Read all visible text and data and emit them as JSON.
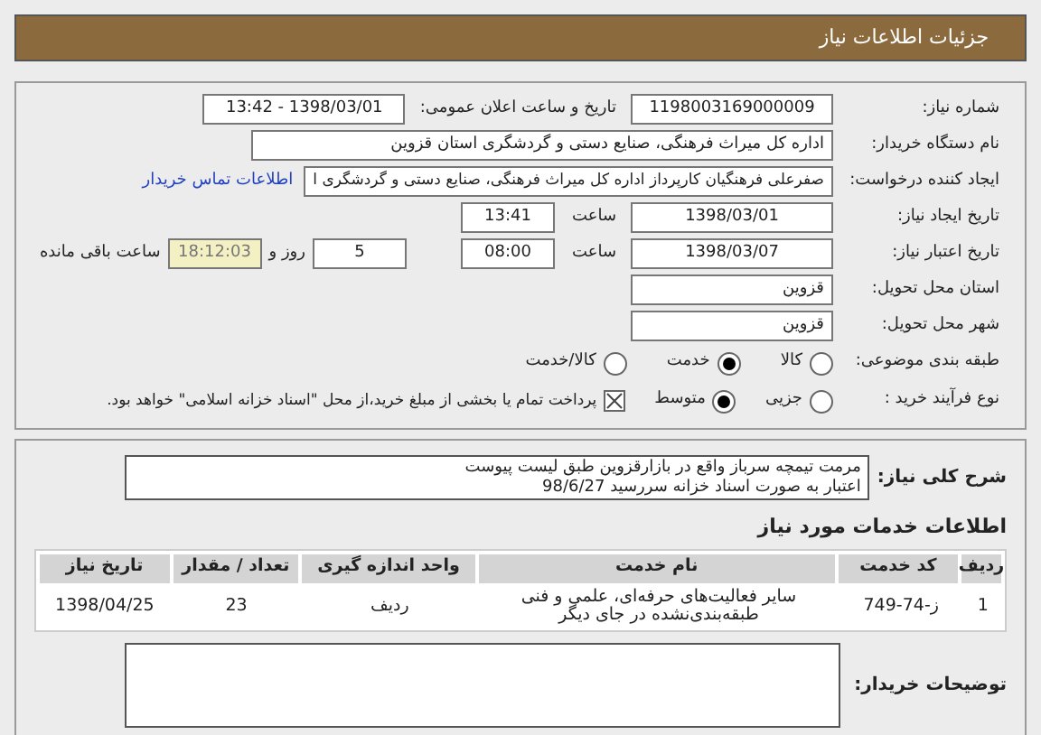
{
  "header": {
    "title": "جزئیات اطلاعات نیاز"
  },
  "fields": {
    "need_number": {
      "label": "شماره نیاز:",
      "value": "1198003169000009"
    },
    "announce": {
      "label": "تاریخ و ساعت اعلان عمومی:",
      "value": "1398/03/01 - 13:42"
    },
    "buyer": {
      "label": "نام دستگاه خریدار:",
      "value": "اداره کل میراث فرهنگی، صنایع دستی و گردشگری استان قزوین"
    },
    "creator": {
      "label": "ایجاد کننده درخواست:",
      "value": "صفرعلی فرهنگیان کارپرداز اداره کل میراث فرهنگی، صنایع دستی و گردشگری ا",
      "link": "اطلاعات تماس خریدار"
    },
    "created": {
      "label": "تاریخ ایجاد نیاز:",
      "date": "1398/03/01",
      "time_label": "ساعت",
      "time": "13:41"
    },
    "validity": {
      "label": "تاریخ اعتبار نیاز:",
      "date": "1398/03/07",
      "time_label": "ساعت",
      "time": "08:00",
      "days": "5",
      "days_label": "روز و",
      "remaining": "18:12:03",
      "remaining_label": "ساعت باقی مانده"
    },
    "province": {
      "label": "استان محل تحویل:",
      "value": "قزوین"
    },
    "city": {
      "label": "شهر محل تحویل:",
      "value": "قزوین"
    }
  },
  "category": {
    "label": "طبقه بندی موضوعی:",
    "options": [
      {
        "label": "کالا",
        "selected": false
      },
      {
        "label": "خدمت",
        "selected": true
      },
      {
        "label": "کالا/خدمت",
        "selected": false
      }
    ]
  },
  "process": {
    "label": "نوع فرآیند خرید :",
    "options": [
      {
        "label": "جزیی",
        "selected": false
      },
      {
        "label": "متوسط",
        "selected": true
      }
    ],
    "treasury": {
      "checked": true,
      "text": "پرداخت تمام یا بخشی از مبلغ خرید،از محل \"اسناد خزانه اسلامی\" خواهد بود."
    }
  },
  "description": {
    "label": "شرح کلی نیاز:",
    "lines": [
      "مرمت تیمچه سرباز واقع در بازارقزوین طبق لیست پیوست",
      "اعتبار به صورت اسناد خزانه سررسید 98/6/27"
    ]
  },
  "services": {
    "title": "اطلاعات خدمات مورد نیاز",
    "columns": [
      "ردیف",
      "کد خدمت",
      "نام خدمت",
      "واحد اندازه گیری",
      "تعداد / مقدار",
      "تاریخ نیاز"
    ],
    "rows": [
      [
        "1",
        "ز-74-749",
        "سایر فعالیت‌های حرفه‌ای، علمی و فنی طبقه‌بندی‌نشده در جای دیگر",
        "ردیف",
        "23",
        "1398/04/25"
      ]
    ]
  },
  "notes": {
    "label": "توضیحات خریدار:"
  }
}
